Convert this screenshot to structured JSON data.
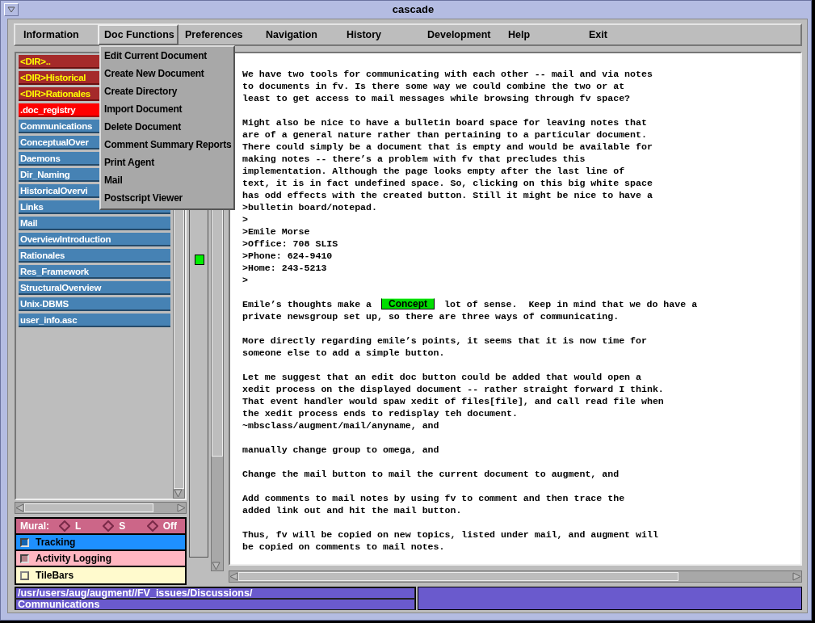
{
  "window": {
    "title": "cascade"
  },
  "menubar": [
    {
      "label": "Information",
      "selected": false
    },
    {
      "label": "Doc Functions",
      "selected": true
    },
    {
      "label": "Preferences",
      "selected": false
    },
    {
      "label": "Navigation",
      "selected": false
    },
    {
      "label": "History",
      "selected": false
    },
    {
      "label": "Development",
      "selected": false
    },
    {
      "label": "Help",
      "selected": false
    },
    {
      "label": "Exit",
      "selected": false
    }
  ],
  "menu": {
    "items": [
      "Edit Current Document",
      "Create New Document",
      "Create Directory",
      "Import Document",
      "Delete Document",
      "Comment Summary Reports",
      "Print Agent",
      "Mail",
      "Postscript Viewer"
    ]
  },
  "files": [
    {
      "kind": "dir",
      "label": "<DIR>.."
    },
    {
      "kind": "dir",
      "label": "<DIR>Historical"
    },
    {
      "kind": "dir",
      "label": "<DIR>Rationales"
    },
    {
      "kind": "registry",
      "label": ".doc_registry"
    },
    {
      "kind": "file",
      "label": "Communications"
    },
    {
      "kind": "file",
      "label": "ConceptualOver"
    },
    {
      "kind": "file",
      "label": "Daemons"
    },
    {
      "kind": "file",
      "label": "Dir_Naming"
    },
    {
      "kind": "file",
      "label": "HistoricalOvervi"
    },
    {
      "kind": "file",
      "label": "Links"
    },
    {
      "kind": "file",
      "label": "Mail"
    },
    {
      "kind": "file",
      "label": "OverviewIntroduction"
    },
    {
      "kind": "file",
      "label": "Rationales"
    },
    {
      "kind": "file",
      "label": "Res_Framework"
    },
    {
      "kind": "file",
      "label": "StructuralOverview"
    },
    {
      "kind": "file",
      "label": "Unix-DBMS"
    },
    {
      "kind": "file",
      "label": "user_info.asc"
    }
  ],
  "mural": {
    "label": "Mural:",
    "options": [
      {
        "label": "L",
        "selected": false
      },
      {
        "label": "S",
        "selected": false
      },
      {
        "label": "Off",
        "selected": false
      }
    ]
  },
  "toggles": [
    {
      "label": "Tracking",
      "checked": true,
      "color": "#1e90ff"
    },
    {
      "label": "Activity Logging",
      "checked": true,
      "color": "#ffb6c1"
    },
    {
      "label": "TileBars",
      "checked": false,
      "color": "#fffacd"
    }
  ],
  "document": {
    "paragraphs": [
      {
        "kind": "text",
        "lines": [
          "We have two tools for communicating with each other -- mail and via notes",
          "to documents in fv. Is there some way we could combine the two or at",
          "least to get access to mail messages while browsing through fv space?"
        ]
      },
      {
        "kind": "text",
        "lines": [
          "Might also be nice to have a bulletin board space for leaving notes that",
          "are of a general nature rather than pertaining to a particular document.",
          "There could simply be a document that is empty and would be available for",
          "making notes -- there’s a problem with fv that precludes this",
          "implementation. Although the page looks empty after the last line of",
          "text, it is in fact undefined space. So, clicking on this big white space",
          "has odd effects with the created button. Still it might be nice to have a",
          ">bulletin board/notepad.",
          ">",
          ">Emile Morse",
          ">Office: 708 SLIS",
          ">Phone: 624-9410",
          ">Home: 243-5213",
          ">"
        ]
      },
      {
        "kind": "with-button",
        "before": "Emile’s thoughts make a",
        "button": "Concept",
        "after": "lot of sense.  Keep in mind that we do have a",
        "lines": [
          "private newsgroup set up, so there are three ways of communicating."
        ]
      },
      {
        "kind": "text",
        "lines": [
          "More directly regarding emile’s points, it seems that it is now time for",
          "someone else to add a simple button."
        ]
      },
      {
        "kind": "text",
        "lines": [
          "Let me suggest that an edit doc button could be added that would open a",
          "xedit process on the displayed document -- rather straight forward I think.",
          "That event handler would spaw xedit of files[file], and call read file when",
          "the xedit process ends to redisplay teh document.",
          "~mbsclass/augment/mail/anyname, and"
        ]
      },
      {
        "kind": "text",
        "lines": [
          "manually change group to omega, and"
        ]
      },
      {
        "kind": "text",
        "lines": [
          "Change the mail button to mail the current document to augment, and"
        ]
      },
      {
        "kind": "text",
        "lines": [
          "Add comments to mail notes by using fv to comment and then trace the",
          "added link out and hit the mail button."
        ]
      },
      {
        "kind": "text",
        "lines": [
          "Thus, fv will be copied on new topics, listed under mail, and augment will",
          "be copied on comments to mail notes."
        ]
      }
    ]
  },
  "status_bar": {
    "path": "/usr/users/aug/augment//FV_issues/Discussions/",
    "document": "Communications"
  }
}
